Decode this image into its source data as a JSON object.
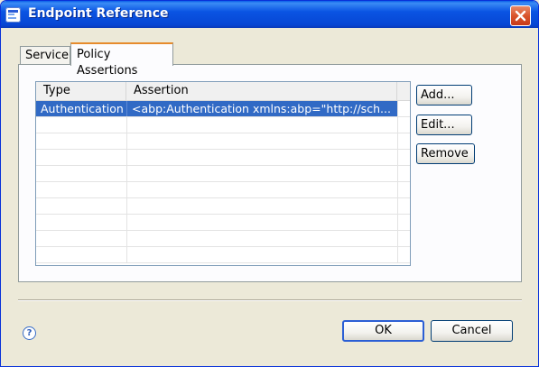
{
  "window": {
    "title": "Endpoint Reference",
    "icon": "endpoint-app-icon",
    "close_icon": "close-icon"
  },
  "tabs": [
    {
      "label": "Service",
      "selected": false
    },
    {
      "label": "Policy Assertions",
      "selected": true
    }
  ],
  "table": {
    "columns": [
      "Type",
      "Assertion"
    ],
    "rows": [
      {
        "type": "Authentication",
        "assertion": "<abp:Authentication xmlns:abp=\"http://sch...",
        "selected": true
      }
    ],
    "empty_rows": 9
  },
  "side_buttons": {
    "add": "Add...",
    "edit": "Edit...",
    "remove": "Remove"
  },
  "footer": {
    "help_icon": "help-icon",
    "ok": "OK",
    "cancel": "Cancel"
  },
  "colors": {
    "titlebar": "#0a54e3",
    "selection": "#316ac5",
    "active_tab_accent": "#e68b2c",
    "close_button": "#d9542c"
  }
}
